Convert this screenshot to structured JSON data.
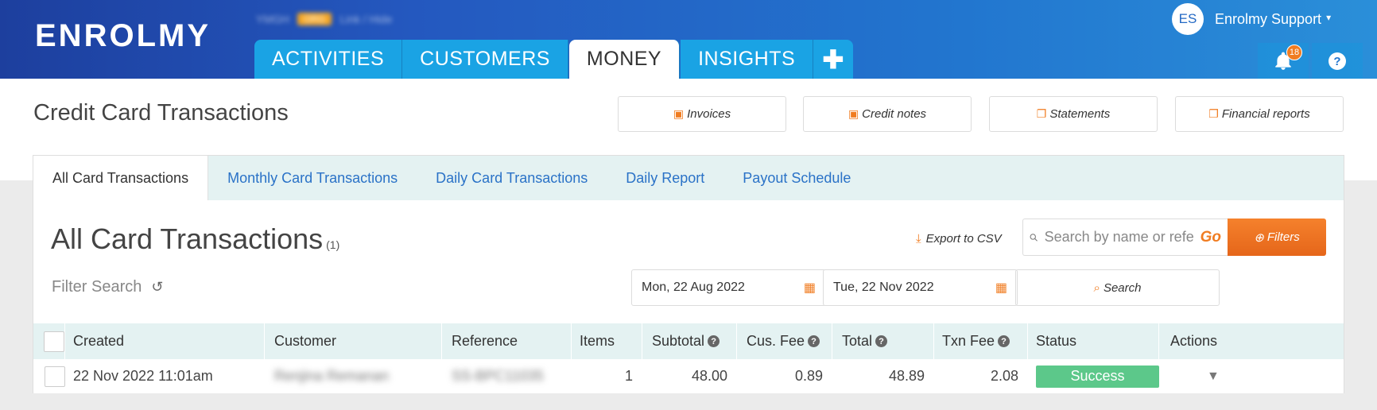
{
  "header": {
    "logo": "ENROLMY",
    "org_name": "YMGH",
    "org_badge": "ORG",
    "org_sub": "Link / Hide",
    "nav_tabs": [
      {
        "label": "ACTIVITIES"
      },
      {
        "label": "CUSTOMERS"
      },
      {
        "label": "MONEY"
      },
      {
        "label": "INSIGHTS"
      }
    ],
    "plus_label": "✚",
    "user": {
      "initials": "ES",
      "name": "Enrolmy Support"
    },
    "notifications_count": "18"
  },
  "page": {
    "title": "Credit Card Transactions",
    "actions": [
      {
        "label": "Invoices",
        "icon": "money-icon"
      },
      {
        "label": "Credit notes",
        "icon": "money-icon"
      },
      {
        "label": "Statements",
        "icon": "copy-icon"
      },
      {
        "label": "Financial reports",
        "icon": "copy-icon"
      }
    ]
  },
  "subtabs": [
    {
      "label": "All Card Transactions"
    },
    {
      "label": "Monthly Card Transactions"
    },
    {
      "label": "Daily Card Transactions"
    },
    {
      "label": "Daily Report"
    },
    {
      "label": "Payout Schedule"
    }
  ],
  "section": {
    "title": "All Card Transactions",
    "count": "(1)",
    "filter_search": "Filter Search",
    "export_label": "Export to CSV",
    "search_placeholder": "Search by name or refe",
    "go_label": "Go",
    "filters_label": "Filters",
    "date_from": "Mon, 22 Aug 2022",
    "date_to": "Tue, 22 Nov 2022",
    "search_btn": "Search"
  },
  "table": {
    "columns": [
      "Created",
      "Customer",
      "Reference",
      "Items",
      "Subtotal",
      "Cus. Fee",
      "Total",
      "Txn Fee",
      "Status",
      "Actions"
    ],
    "rows": [
      {
        "created": "22 Nov 2022 11:01am",
        "customer": "Renjina Remanan",
        "reference": "SS-BPC11035",
        "items": "1",
        "subtotal": "48.00",
        "cus_fee": "0.89",
        "total": "48.89",
        "txn_fee": "2.08",
        "status": "Success"
      }
    ]
  },
  "colors": {
    "accent_orange": "#f07c21",
    "nav_blue": "#1aa3e4",
    "link_blue": "#2a72c7",
    "success_green": "#5cc88a"
  }
}
